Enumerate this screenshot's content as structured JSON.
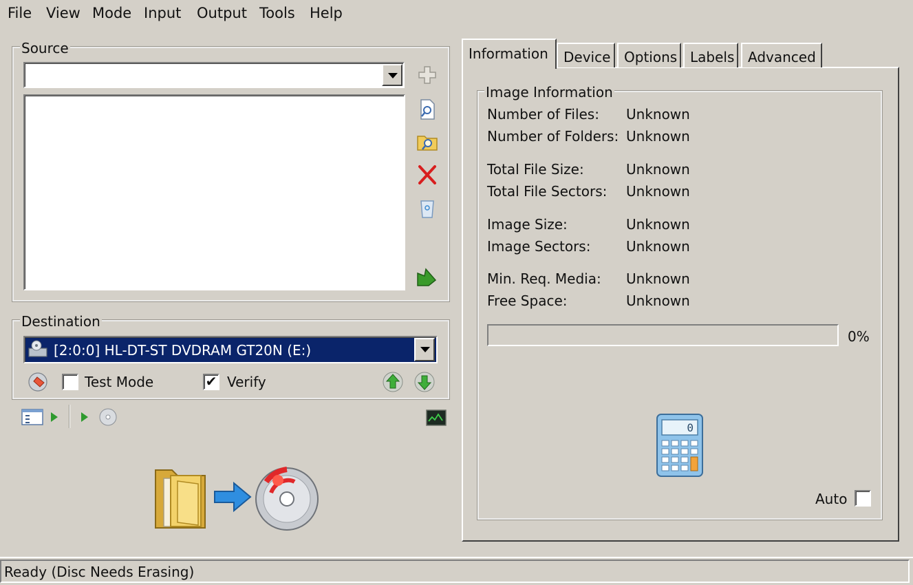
{
  "menu": {
    "file": "File",
    "view": "View",
    "mode": "Mode",
    "input": "Input",
    "output": "Output",
    "tools": "Tools",
    "help": "Help"
  },
  "source": {
    "title": "Source",
    "selected": "",
    "files": []
  },
  "destination": {
    "title": "Destination",
    "drive": "[2:0:0] HL-DT-ST DVDRAM GT20N (E:)",
    "test_mode_label": "Test Mode",
    "test_mode_checked": false,
    "verify_label": "Verify",
    "verify_checked": true
  },
  "tabs": {
    "information": "Information",
    "device": "Device",
    "options": "Options",
    "labels": "Labels",
    "advanced": "Advanced",
    "active": "information"
  },
  "image_info": {
    "title": "Image Information",
    "number_of_files_label": "Number of Files:",
    "number_of_files_value": "Unknown",
    "number_of_folders_label": "Number of Folders:",
    "number_of_folders_value": "Unknown",
    "total_file_size_label": "Total File Size:",
    "total_file_size_value": "Unknown",
    "total_file_sectors_label": "Total File Sectors:",
    "total_file_sectors_value": "Unknown",
    "image_size_label": "Image Size:",
    "image_size_value": "Unknown",
    "image_sectors_label": "Image Sectors:",
    "image_sectors_value": "Unknown",
    "min_req_media_label": "Min. Req. Media:",
    "min_req_media_value": "Unknown",
    "free_space_label": "Free Space:",
    "free_space_value": "Unknown",
    "progress_percent": 0,
    "progress_text": "0%",
    "calculator_display": "0",
    "auto_label": "Auto",
    "auto_checked": false
  },
  "status": {
    "text": "Ready (Disc Needs Erasing)"
  },
  "icons": {
    "add": "plus-icon",
    "browse_file": "browse-file-icon",
    "browse_folder": "browse-folder-icon",
    "remove": "remove-icon",
    "clear": "recycle-bin-icon",
    "build": "build-arrow-icon",
    "drive": "dvd-drive-icon",
    "erase": "erase-disc-icon",
    "eject_up": "eject-up-icon",
    "load_down": "load-down-icon",
    "log": "log-window-icon",
    "calculator": "calculator-icon",
    "big_folder": "folder-icon",
    "big_arrow": "arrow-right-icon",
    "big_disc": "disc-burn-icon"
  },
  "colors": {
    "window_bg": "#d4d0c8",
    "selection_bg": "#0a246a",
    "selection_text": "#ffffff",
    "remove_red": "#d81e1e",
    "build_green": "#3a9a2a"
  }
}
